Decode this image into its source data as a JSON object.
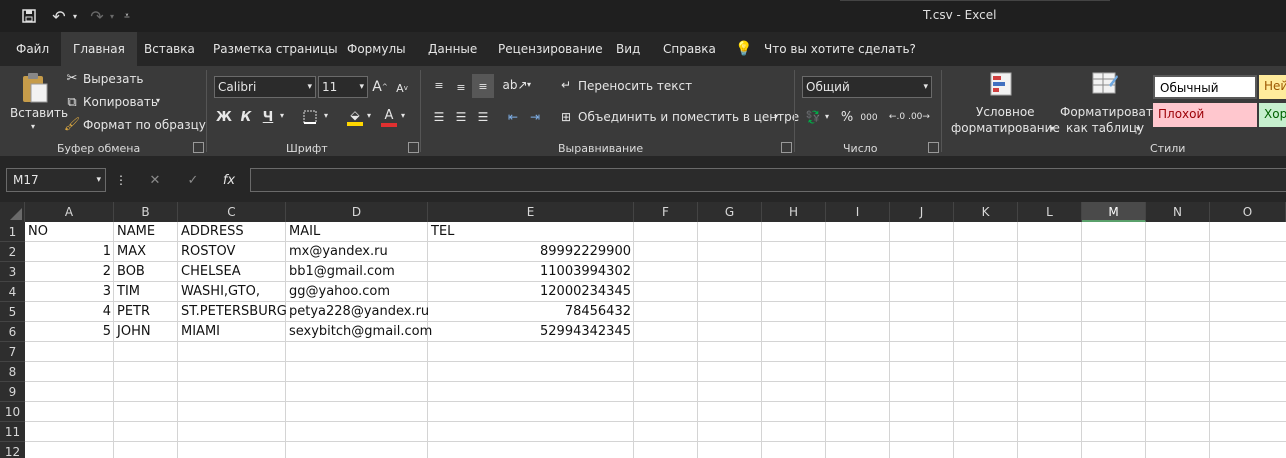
{
  "window": {
    "title": "T.csv  -  Excel"
  },
  "tabs": [
    "Файл",
    "Главная",
    "Вставка",
    "Разметка страницы",
    "Формулы",
    "Данные",
    "Рецензирование",
    "Вид",
    "Справка"
  ],
  "active_tab": "Главная",
  "tell_me": "Что вы хотите сделать?",
  "clipboard": {
    "paste": "Вставить",
    "cut": "Вырезать",
    "copy": "Копировать",
    "format_painter": "Формат по образцу",
    "label": "Буфер обмена"
  },
  "font": {
    "name": "Calibri",
    "size": "11",
    "bold": "Ж",
    "italic": "К",
    "underline": "Ч",
    "grow": "A",
    "shrink": "A",
    "label": "Шрифт",
    "fill_color": "#ffd700",
    "font_color": "#e03030"
  },
  "alignment": {
    "wrap": "Переносить текст",
    "merge": "Объединить и поместить в центре",
    "label": "Выравнивание"
  },
  "number": {
    "format": "Общий",
    "percent": "%",
    "thousands": "000",
    "label": "Число"
  },
  "styles": {
    "conditional_line1": "Условное",
    "conditional_line2": "форматирование",
    "table_line1": "Форматировать",
    "table_line2": "как таблицу",
    "normal": "Обычный",
    "neutral": "Ней",
    "bad": "Плохой",
    "good": "Хор",
    "label": "Стили"
  },
  "formula_bar": {
    "name_box": "M17",
    "fx": "fx",
    "value": ""
  },
  "sheet": {
    "columns": [
      "A",
      "B",
      "C",
      "D",
      "E",
      "F",
      "G",
      "H",
      "I",
      "J",
      "K",
      "L",
      "M",
      "N",
      "O"
    ],
    "selected_column": "M",
    "row_numbers": [
      "1",
      "2",
      "3",
      "4",
      "5",
      "6",
      "7",
      "8",
      "9",
      "10",
      "11",
      "12"
    ],
    "rows": [
      [
        "NO",
        "NAME",
        "ADDRESS",
        "MAIL",
        "TEL"
      ],
      [
        "1",
        "MAX",
        "ROSTOV",
        "mx@yandex.ru",
        "89992229900"
      ],
      [
        "2",
        "BOB",
        "CHELSEA",
        "bb1@gmail.com",
        "11003994302"
      ],
      [
        "3",
        "TIM",
        "WASHI,GTO,",
        "gg@yahoo.com",
        "12000234345"
      ],
      [
        "4",
        "PETR",
        "ST.PETERSBURG",
        "petya228@yandex.ru",
        "78456432"
      ],
      [
        "5",
        "JOHN",
        "MIAMI",
        "sexybitch@gmail.com",
        "52994342345"
      ]
    ]
  }
}
